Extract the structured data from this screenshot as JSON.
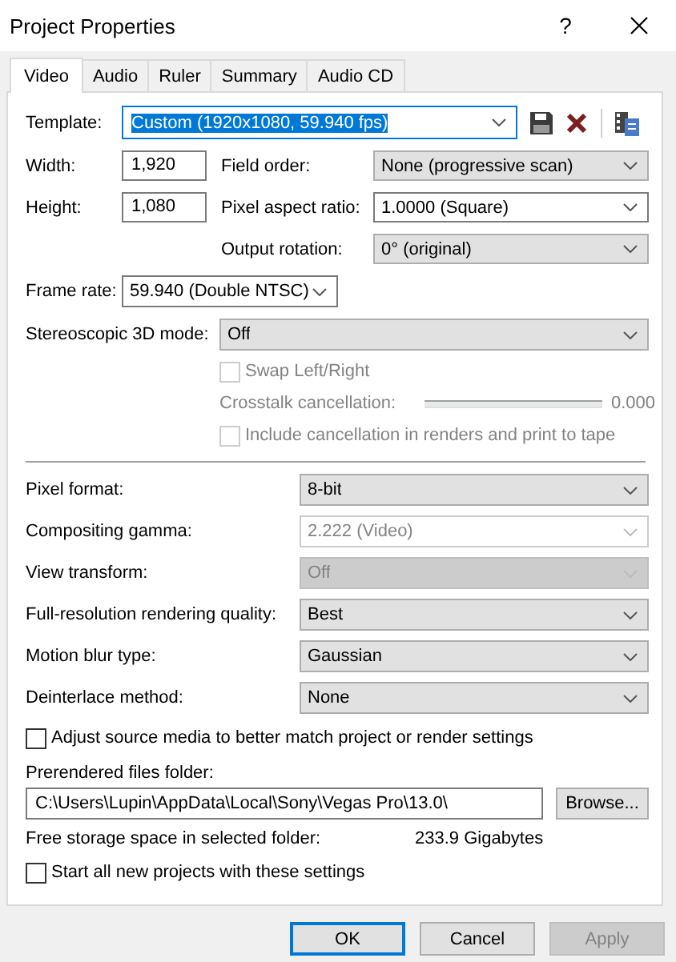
{
  "window": {
    "title": "Project Properties",
    "help": "?"
  },
  "tabs": [
    {
      "label": "Video",
      "selected": true
    },
    {
      "label": "Audio",
      "selected": false
    },
    {
      "label": "Ruler",
      "selected": false
    },
    {
      "label": "Summary",
      "selected": false
    },
    {
      "label": "Audio CD",
      "selected": false
    }
  ],
  "template": {
    "label": "Template:",
    "value": "Custom (1920x1080, 59.940 fps)",
    "highlighted": true
  },
  "size_rows": [
    {
      "label": "Width:",
      "value": "1,920",
      "setting": {
        "label": "Field order:",
        "value": "None (progressive scan)",
        "kind": "combo",
        "disabled": false
      }
    },
    {
      "label": "Height:",
      "value": "1,080",
      "setting": {
        "label": "Pixel aspect ratio:",
        "value": "1.0000 (Square)",
        "kind": "edit",
        "disabled": false
      }
    }
  ],
  "output_rotation": {
    "label": "Output rotation:",
    "value": "0° (original)",
    "kind": "combo",
    "disabled": false
  },
  "frame_rate": {
    "label": "Frame rate:",
    "value": "59.940 (Double NTSC)",
    "kind": "edit",
    "disabled": false
  },
  "stereo": {
    "label": "Stereoscopic 3D mode:",
    "value": "Off",
    "kind": "combo",
    "disabled": false
  },
  "swap": {
    "label": "Swap Left/Right",
    "checked": false,
    "disabled": true
  },
  "crosstalk": {
    "label": "Crosstalk cancellation:",
    "reading": "0.000",
    "disabled": true
  },
  "include": {
    "label": "Include cancellation in renders and print to tape",
    "checked": false,
    "disabled": true
  },
  "settings": [
    {
      "label": "Pixel format:",
      "value": "8-bit",
      "kind": "combo",
      "disabled": false
    },
    {
      "label": "Compositing gamma:",
      "value": "2.222 (Video)",
      "kind": "edit",
      "disabled": true
    },
    {
      "label": "View transform:",
      "value": "Off",
      "kind": "combo",
      "disabled": true
    },
    {
      "label": "Full-resolution rendering quality:",
      "value": "Best",
      "kind": "combo",
      "disabled": false
    },
    {
      "label": "Motion blur type:",
      "value": "Gaussian",
      "kind": "combo",
      "disabled": false
    },
    {
      "label": "Deinterlace method:",
      "value": "None",
      "kind": "combo",
      "disabled": false
    }
  ],
  "adjust": {
    "label": "Adjust source media to better match project or render settings",
    "checked": false,
    "disabled": false
  },
  "prerendered": {
    "label": "Prerendered files folder:",
    "value": "C:\\Users\\Lupin\\AppData\\Local\\Sony\\Vegas Pro\\13.0\\",
    "browse": "Browse..."
  },
  "free_space": {
    "label": "Free storage space in selected folder:",
    "value": "233.9 Gigabytes"
  },
  "start": {
    "label": "Start all new projects with these settings",
    "checked": false,
    "disabled": false
  },
  "buttons": [
    {
      "label": "OK",
      "default": true,
      "disabled": false
    },
    {
      "label": "Cancel",
      "default": false,
      "disabled": false
    },
    {
      "label": "Apply",
      "default": false,
      "disabled": true
    }
  ]
}
